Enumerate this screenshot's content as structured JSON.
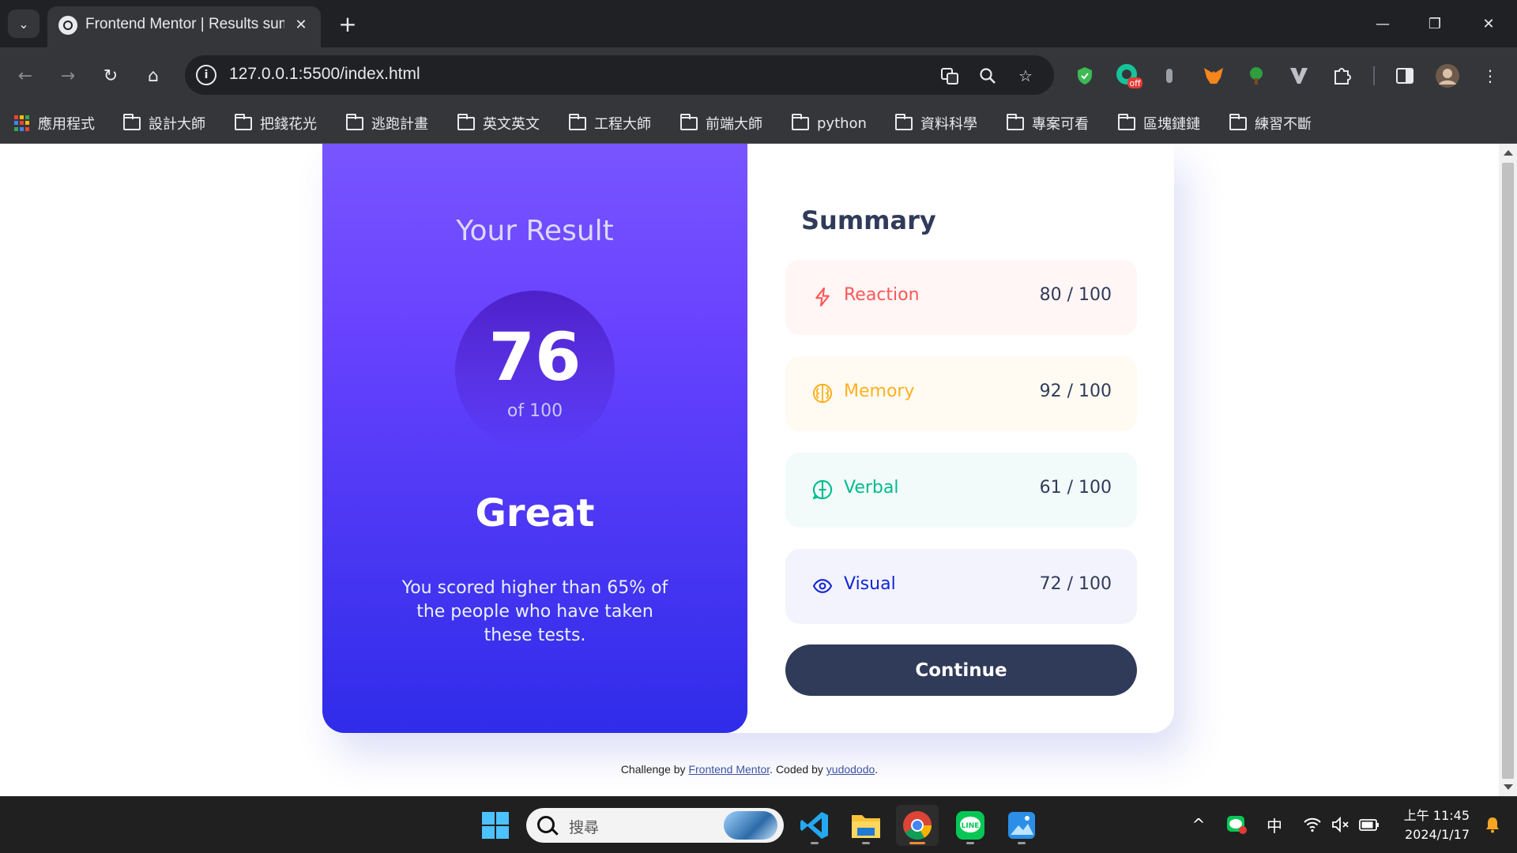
{
  "browser": {
    "tab_title": "Frontend Mentor | Results summary component",
    "url": "127.0.0.1:5500/index.html",
    "extension_badge": "off",
    "bookmarks": [
      {
        "label": "應用程式",
        "icon": "apps-icon"
      },
      {
        "label": "設計大師",
        "icon": "folder-icon"
      },
      {
        "label": "把錢花光",
        "icon": "folder-icon"
      },
      {
        "label": "逃跑計畫",
        "icon": "folder-icon"
      },
      {
        "label": "英文英文",
        "icon": "folder-icon"
      },
      {
        "label": "工程大師",
        "icon": "folder-icon"
      },
      {
        "label": "前端大師",
        "icon": "folder-icon"
      },
      {
        "label": "python",
        "icon": "folder-icon"
      },
      {
        "label": "資料科學",
        "icon": "folder-icon"
      },
      {
        "label": "專案可看",
        "icon": "folder-icon"
      },
      {
        "label": "區塊鏈鏈",
        "icon": "folder-icon"
      },
      {
        "label": "練習不斷",
        "icon": "folder-icon"
      }
    ]
  },
  "result": {
    "title": "Your Result",
    "score": "76",
    "of_label": "of 100",
    "grade": "Great",
    "description": "You scored higher than 65% of the people who have taken these tests."
  },
  "summary": {
    "title": "Summary",
    "categories": [
      {
        "label": "Reaction",
        "score": "80",
        "max": "/ 100",
        "icon": "lightning-icon",
        "color": "#ff5757",
        "bg": "#fff6f5"
      },
      {
        "label": "Memory",
        "score": "92",
        "max": "/ 100",
        "icon": "brain-icon",
        "color": "#ffb01f",
        "bg": "#fffbf2"
      },
      {
        "label": "Verbal",
        "score": "61",
        "max": "/ 100",
        "icon": "chat-icon",
        "color": "#00bb8f",
        "bg": "#f2fbfa"
      },
      {
        "label": "Visual",
        "score": "72",
        "max": "/ 100",
        "icon": "eye-icon",
        "color": "#1125d6",
        "bg": "#f3f3fd"
      }
    ],
    "continue_label": "Continue"
  },
  "attribution": {
    "prefix": "Challenge by ",
    "link1": "Frontend Mentor",
    "middle": ". Coded by ",
    "link2": "yudododo",
    "suffix": "."
  },
  "taskbar": {
    "search_placeholder": "搜尋",
    "ime_label": "中",
    "time": "上午 11:45",
    "date": "2024/1/17"
  },
  "colors": {
    "gradient_top": "#7755ff",
    "gradient_bottom": "#2f2ce9",
    "dark_navy": "#303b5a"
  }
}
